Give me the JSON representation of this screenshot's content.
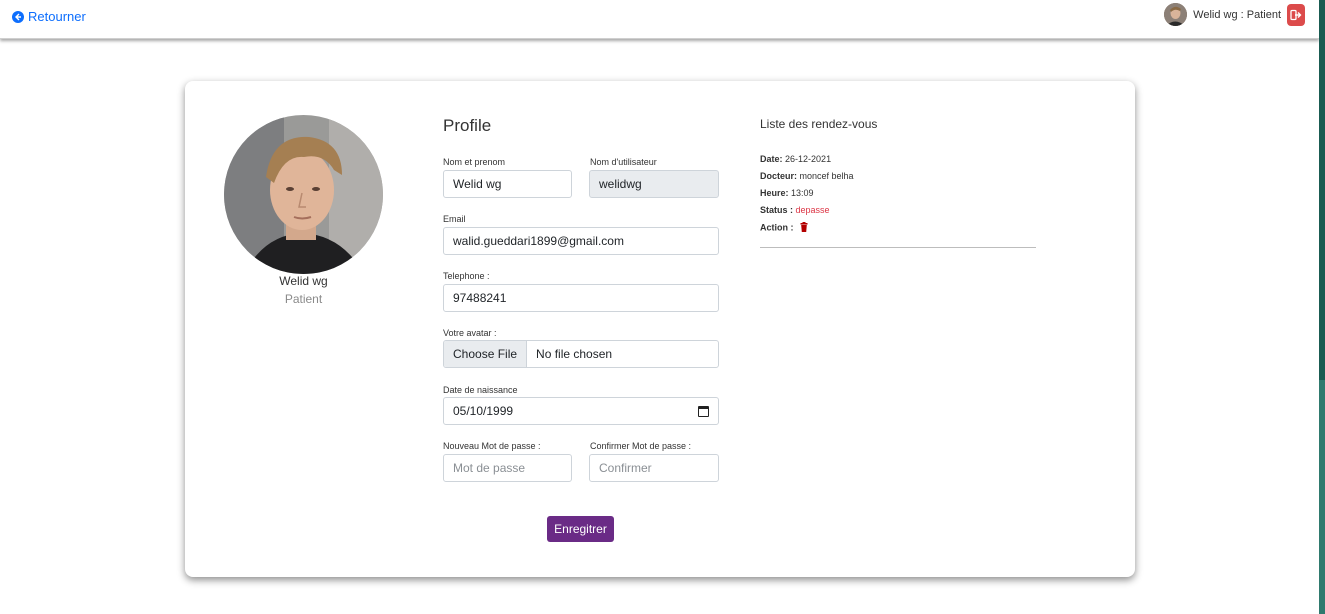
{
  "nav": {
    "back_label": "Retourner",
    "user_label": "Welid wg : Patient"
  },
  "profile": {
    "name": "Welid wg",
    "role": "Patient"
  },
  "form": {
    "title": "Profile",
    "fullname_label": "Nom et prenom",
    "fullname_value": "Welid wg",
    "username_label": "Nom d'utilisateur",
    "username_value": "welidwg",
    "email_label": "Email",
    "email_value": "walid.gueddari1899@gmail.com",
    "phone_label": "Telephone :",
    "phone_value": "97488241",
    "avatar_label": "Votre avatar :",
    "file_button": "Choose File",
    "file_status": "No file chosen",
    "birth_label": "Date de naissance",
    "birth_value": "05/10/1999",
    "new_password_label": "Nouveau Mot de passe :",
    "new_password_placeholder": "Mot de passe",
    "confirm_password_label": "Confirmer Mot de passe :",
    "confirm_password_placeholder": "Confirmer",
    "save_label": "Enregitrer"
  },
  "appointments": {
    "title": "Liste des rendez-vous",
    "items": [
      {
        "date_label": "Date:",
        "date": "26-12-2021",
        "doctor_label": "Docteur:",
        "doctor": "moncef belha",
        "time_label": "Heure:",
        "time": "13:09",
        "status_label": "Status :",
        "status": "depasse",
        "action_label": "Action :"
      }
    ]
  },
  "colors": {
    "link": "#0d6efd",
    "primary_button": "#6a2b86",
    "logout": "#dc4b4b",
    "status_red": "#dc3545"
  },
  "icons": {
    "back": "arrow-circle-left-icon",
    "logout": "sign-out-icon",
    "calendar": "calendar-icon",
    "delete": "trash-icon"
  }
}
